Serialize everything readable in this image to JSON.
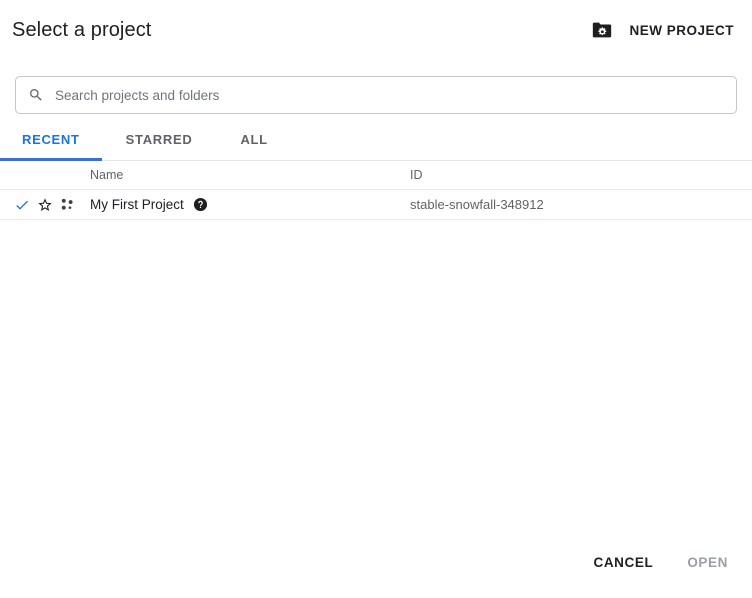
{
  "dialog": {
    "title": "Select a project",
    "new_project": {
      "label": "NEW PROJECT",
      "icon": "new-project-folder-icon"
    }
  },
  "search": {
    "placeholder": "Search projects and folders",
    "value": "",
    "icon": "search-icon"
  },
  "tabs": [
    {
      "label": "RECENT",
      "active": true
    },
    {
      "label": "STARRED",
      "active": false
    },
    {
      "label": "ALL",
      "active": false
    }
  ],
  "table": {
    "columns": [
      {
        "key": "name",
        "label": "Name"
      },
      {
        "key": "id",
        "label": "ID"
      }
    ],
    "rows": [
      {
        "selected": true,
        "starred": false,
        "type_icon": "project-dots-icon",
        "name": "My First Project",
        "help_icon": "help-circle-icon",
        "id": "stable-snowfall-348912"
      }
    ]
  },
  "footer": {
    "cancel_label": "CANCEL",
    "open_label": "OPEN",
    "open_disabled": true
  },
  "colors": {
    "accent_blue": "#1a73e8",
    "tab_underline": "#3b6fd4",
    "text_primary": "#202124",
    "text_secondary": "#5f6368",
    "text_disabled": "#9aa0a6",
    "border": "#e8eaed",
    "input_border": "#c4c7c5",
    "surface": "#ffffff"
  }
}
